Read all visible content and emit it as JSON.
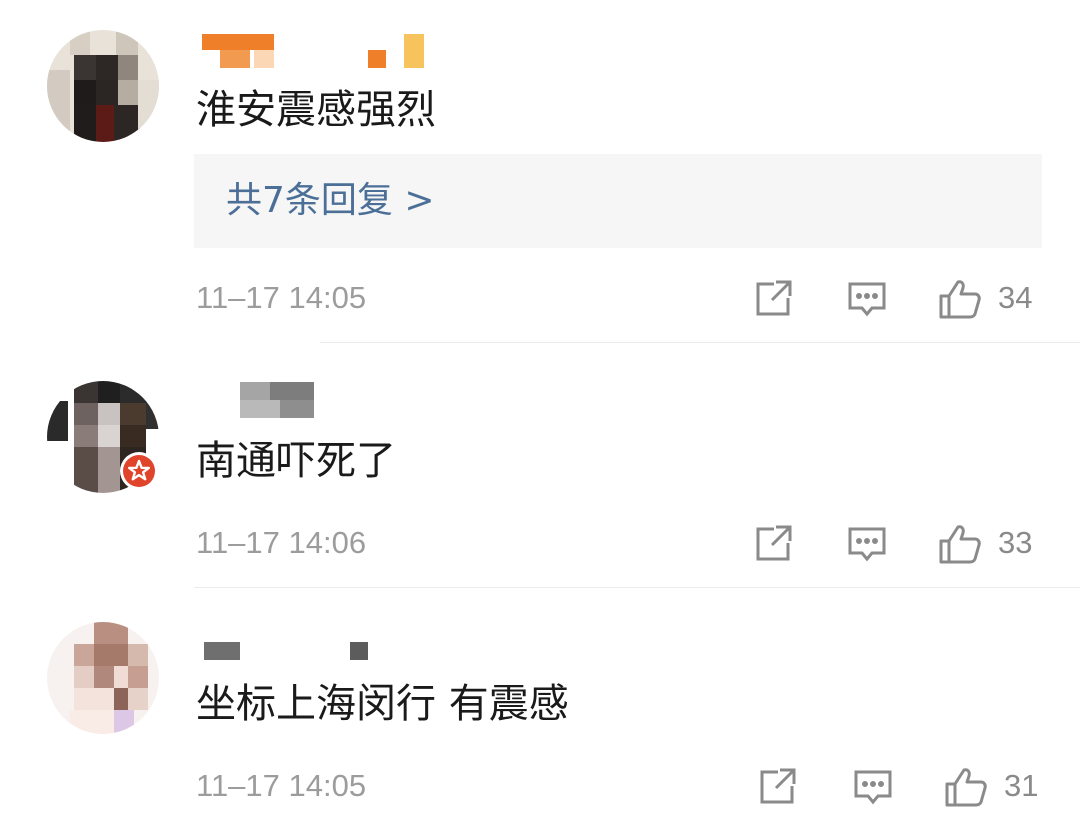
{
  "comments": [
    {
      "text": "淮安震感强烈",
      "reply_summary": "共7条回复 >",
      "time": "11–17 14:05",
      "likes": "34"
    },
    {
      "text": "南通吓死了",
      "time": "11–17 14:06",
      "likes": "33"
    },
    {
      "text": "坐标上海闵行 有震感",
      "time": "11–17 14:05",
      "likes": "31"
    }
  ],
  "icons": {
    "share": "share-icon",
    "comment": "comment-icon",
    "like": "thumbs-up-icon",
    "badge": "red-star-badge-icon"
  },
  "colors": {
    "reply_link": "#4c6f98",
    "meta_text": "#9c9c9c",
    "badge": "#e0442a"
  }
}
